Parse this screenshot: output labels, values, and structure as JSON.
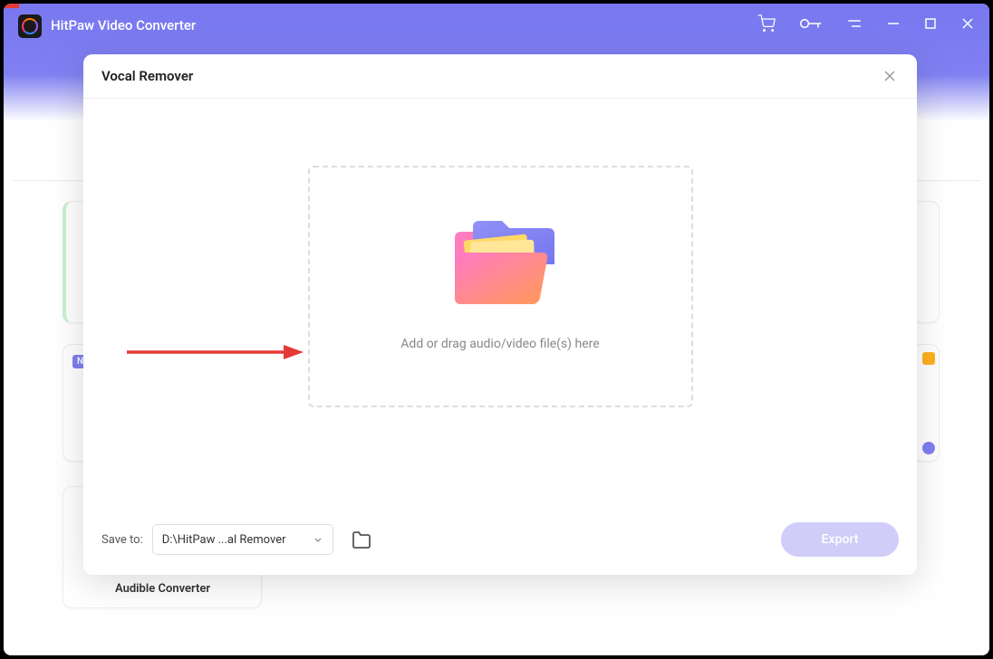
{
  "app": {
    "title": "HitPaw Video Converter"
  },
  "background": {
    "new_badge": "N",
    "audible_label": "Audible Converter"
  },
  "modal": {
    "title": "Vocal Remover",
    "dropzone_text": "Add or drag audio/video file(s) here",
    "save_label": "Save to:",
    "save_path": "D:\\HitPaw ...al Remover",
    "export_label": "Export"
  }
}
